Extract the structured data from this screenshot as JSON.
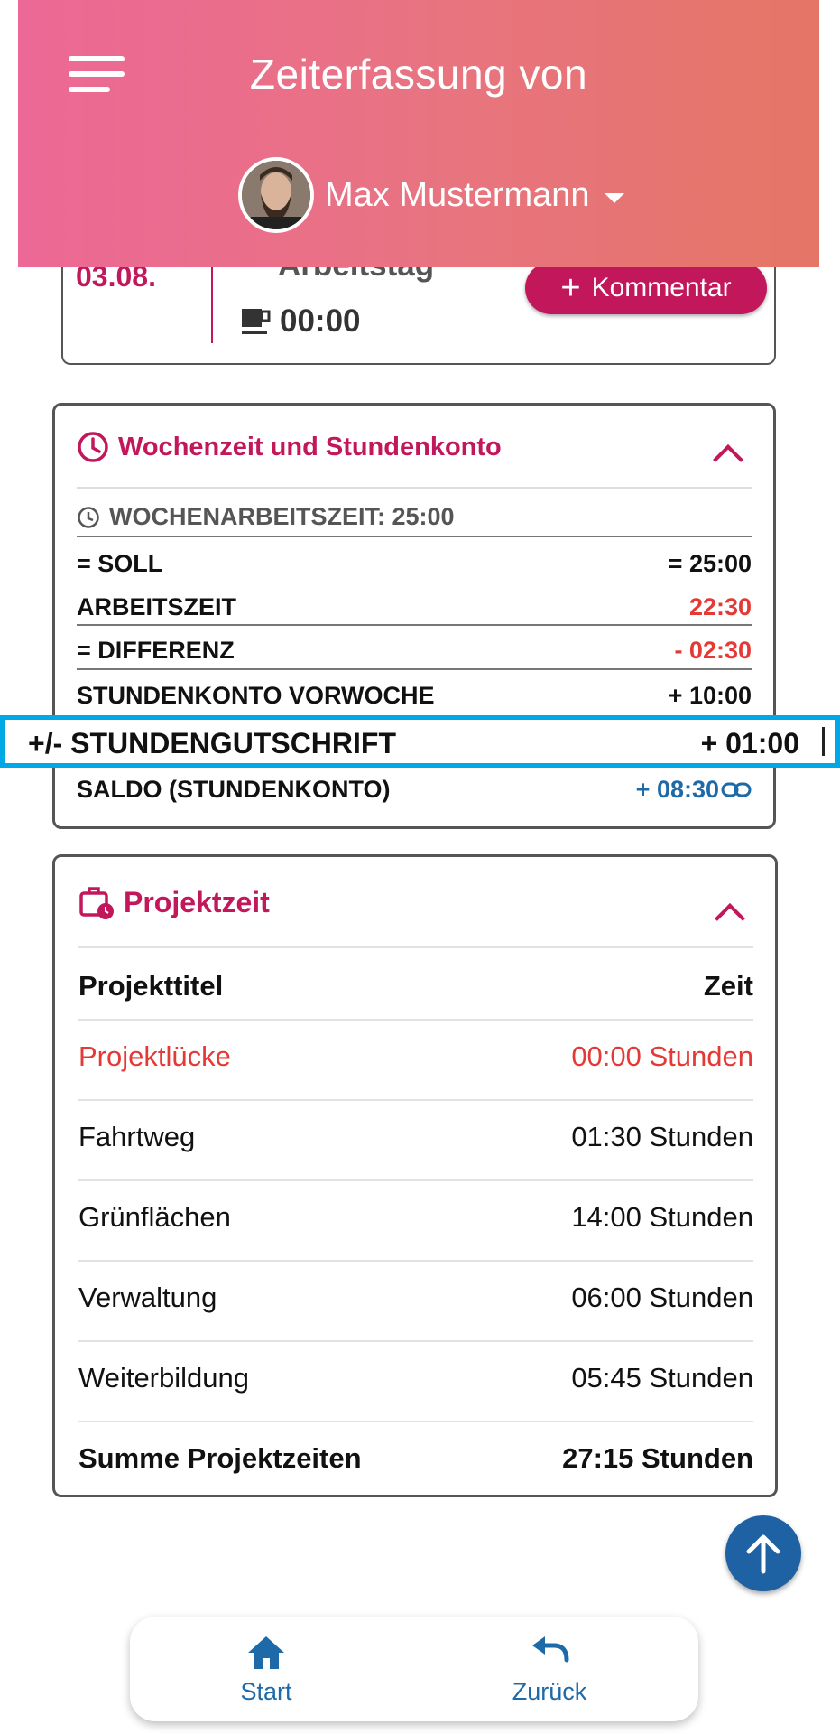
{
  "header": {
    "title": "Zeiterfassung von",
    "user_name": "Max Mustermann"
  },
  "day": {
    "date": "03.08.",
    "type": "Arbeitstag",
    "break_time": "00:00",
    "comment_button": "Kommentar"
  },
  "week": {
    "title": "Wochenzeit und Stundenkonto",
    "weekly_hours": "WOCHENARBEITSZEIT: 25:00",
    "rows": [
      {
        "label": "= SOLL",
        "value": "= 25:00",
        "color": "#111111"
      },
      {
        "label": "ARBEITSZEIT",
        "value": "22:30",
        "color": "#e53935"
      },
      {
        "label": "= DIFFERENZ",
        "value": "- 02:30",
        "color": "#e53935"
      },
      {
        "label": "STUNDENKONTO VORWOCHE",
        "value": "+ 10:00",
        "color": "#111111"
      }
    ],
    "credit": {
      "label": "+/- STUNDENGUTSCHRIFT",
      "value": "+ 01:00"
    },
    "balance": {
      "label": "SALDO (STUNDENKONTO)",
      "value": "+ 08:30"
    }
  },
  "projects": {
    "title": "Projektzeit",
    "col_title": "Projekttitel",
    "col_time": "Zeit",
    "rows": [
      {
        "name": "Projektlücke",
        "time": "00:00 Stunden",
        "color": "#e53935"
      },
      {
        "name": "Fahrtweg",
        "time": "01:30 Stunden",
        "color": "#111111"
      },
      {
        "name": "Grünflächen",
        "time": "14:00 Stunden",
        "color": "#111111"
      },
      {
        "name": "Verwaltung",
        "time": "06:00 Stunden",
        "color": "#111111"
      },
      {
        "name": "Weiterbildung",
        "time": "05:45 Stunden",
        "color": "#111111"
      }
    ],
    "total_label": "Summe Projektzeiten",
    "total_value": "27:15 Stunden"
  },
  "nav": {
    "start": "Start",
    "back": "Zurück"
  },
  "colors": {
    "accent": "#c2185b",
    "header_from": "#ec6896",
    "header_to": "#e57566",
    "link_blue": "#1e6aa8",
    "negative": "#e53935",
    "highlight": "#00a9e6"
  }
}
